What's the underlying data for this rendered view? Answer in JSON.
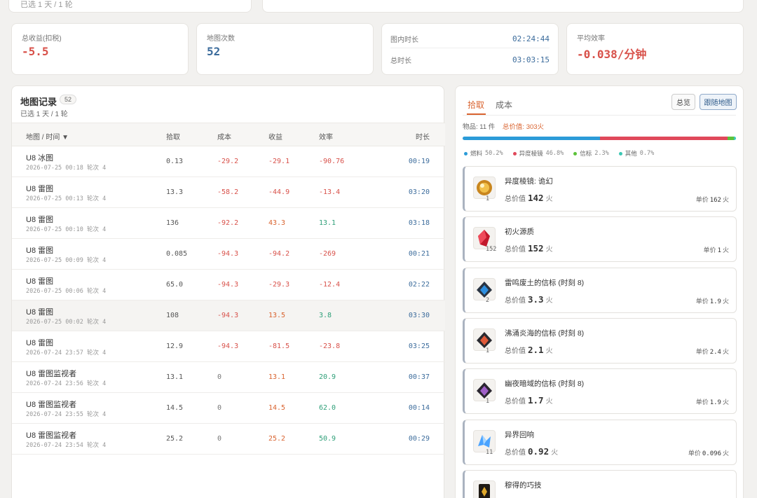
{
  "top": {
    "subtitle": "已选 1 天 / 1 轮"
  },
  "stats": {
    "total_income": {
      "label": "总收益(扣税)",
      "value": "-5.5"
    },
    "map_count": {
      "label": "地图次数",
      "value": "52"
    },
    "times": {
      "in_map_label": "图内时长",
      "in_map_value": "02:24:44",
      "total_label": "总时长",
      "total_value": "03:03:15"
    },
    "avg_eff": {
      "label": "平均效率",
      "value": "-0.038/分钟"
    }
  },
  "records": {
    "title": "地图记录",
    "count": "52",
    "filter": "已选 1 天 / 1 轮",
    "headers": {
      "map": "地图 / 时间 ▼",
      "pickup": "拾取",
      "cost": "成本",
      "income": "收益",
      "eff": "效率",
      "duration": "时长"
    },
    "rows": [
      {
        "name": "U8 冰图",
        "date": "2026-07-25 00:18 轮次 4",
        "pickup": "0.13",
        "cost": "-29.2",
        "income": "-29.1",
        "eff": "-90.76",
        "duration": "00:19"
      },
      {
        "name": "U8 雷图",
        "date": "2026-07-25 00:13 轮次 4",
        "pickup": "13.3",
        "cost": "-58.2",
        "income": "-44.9",
        "eff": "-13.4",
        "duration": "03:20"
      },
      {
        "name": "U8 雷图",
        "date": "2026-07-25 00:10 轮次 4",
        "pickup": "136",
        "cost": "-92.2",
        "income": "43.3",
        "eff": "13.1",
        "duration": "03:18"
      },
      {
        "name": "U8 雷图",
        "date": "2026-07-25 00:09 轮次 4",
        "pickup": "0.085",
        "cost": "-94.3",
        "income": "-94.2",
        "eff": "-269",
        "duration": "00:21"
      },
      {
        "name": "U8 雷图",
        "date": "2026-07-25 00:06 轮次 4",
        "pickup": "65.0",
        "cost": "-94.3",
        "income": "-29.3",
        "eff": "-12.4",
        "duration": "02:22"
      },
      {
        "name": "U8 雷图",
        "date": "2026-07-25 00:02 轮次 4",
        "pickup": "108",
        "cost": "-94.3",
        "income": "13.5",
        "eff": "3.8",
        "duration": "03:30"
      },
      {
        "name": "U8 雷图",
        "date": "2026-07-24 23:57 轮次 4",
        "pickup": "12.9",
        "cost": "-94.3",
        "income": "-81.5",
        "eff": "-23.8",
        "duration": "03:25"
      },
      {
        "name": "U8 雷图监视者",
        "date": "2026-07-24 23:56 轮次 4",
        "pickup": "13.1",
        "cost": "0",
        "income": "13.1",
        "eff": "20.9",
        "duration": "00:37"
      },
      {
        "name": "U8 雷图监视者",
        "date": "2026-07-24 23:55 轮次 4",
        "pickup": "14.5",
        "cost": "0",
        "income": "14.5",
        "eff": "62.0",
        "duration": "00:14"
      },
      {
        "name": "U8 雷图监视者",
        "date": "2026-07-24 23:54 轮次 4",
        "pickup": "25.2",
        "cost": "0",
        "income": "25.2",
        "eff": "50.9",
        "duration": "00:29"
      }
    ]
  },
  "pickup_panel": {
    "tab_pickup": "拾取",
    "tab_cost": "成本",
    "btn_overview": "总览",
    "btn_follow": "跟随地图",
    "items_label": "物品: 11 件",
    "total_value_label": "总价值: 303火",
    "legend": [
      {
        "name": "燃料",
        "pct": "50.2%",
        "share": 0.502,
        "color": "#2b9bd8"
      },
      {
        "name": "异度棱镜",
        "pct": "46.8%",
        "share": 0.468,
        "color": "#e0485a"
      },
      {
        "name": "信标",
        "pct": "2.3%",
        "share": 0.023,
        "color": "#5cc23a"
      },
      {
        "name": "其他",
        "pct": "0.7%",
        "share": 0.007,
        "color": "#3bc7b4"
      }
    ],
    "total_prefix": "总价值",
    "unit": "火",
    "price_prefix": "单价",
    "items": [
      {
        "name": "异度棱镜: 诡幻",
        "qty": "1",
        "total": "142",
        "price": "162",
        "icon": "orange-orb-icon"
      },
      {
        "name": "初火源质",
        "qty": "152",
        "total": "152",
        "price": "1",
        "icon": "red-crystal-icon"
      },
      {
        "name": "雷鸣废土的信标 (时刻 8)",
        "qty": "2",
        "total": "3.3",
        "price": "1.9",
        "icon": "blue-beacon-icon"
      },
      {
        "name": "沸涌炎海的信标 (时刻 8)",
        "qty": "1",
        "total": "2.1",
        "price": "2.4",
        "icon": "red-beacon-icon"
      },
      {
        "name": "幽夜暗域的信标 (时刻 8)",
        "qty": "1",
        "total": "1.7",
        "price": "1.9",
        "icon": "purple-beacon-icon"
      },
      {
        "name": "异界回响",
        "qty": "11",
        "total": "0.92",
        "price": "0.096",
        "icon": "blue-shard-icon"
      },
      {
        "name": "穆得的巧技",
        "qty": "",
        "total": "",
        "price": "",
        "icon": "gold-card-icon"
      }
    ]
  }
}
